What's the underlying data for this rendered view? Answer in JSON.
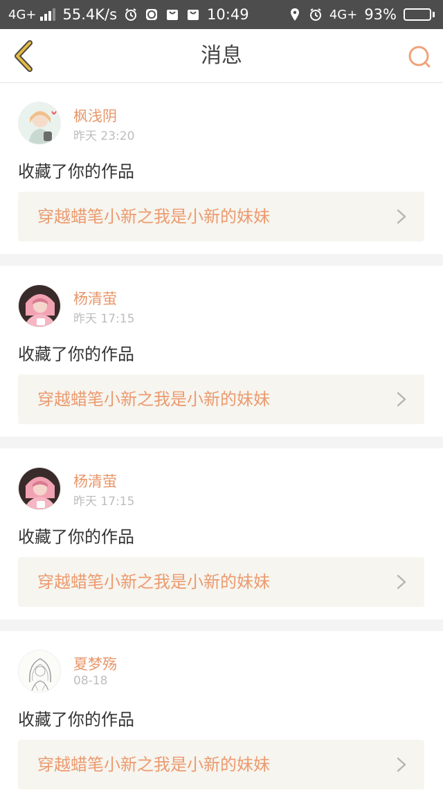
{
  "status_bar": {
    "network_left": "4G+",
    "speed": "55.4K/s",
    "time": "10:49",
    "network_right": "4G+",
    "battery_percent": "93%",
    "battery_level": 0.93,
    "icons_left": [
      "signal-icon",
      "alarm-icon",
      "app-icon",
      "bag-icon",
      "bag-icon"
    ],
    "icons_right": [
      "location-icon",
      "alarm-icon"
    ]
  },
  "nav": {
    "title": "消息",
    "back_icon": "chevron-left-icon",
    "search_icon": "search-icon",
    "accent": "#e0a93a",
    "search_color": "#f0a27a"
  },
  "colors": {
    "username": "#e79668",
    "work_title": "#ec9a6f",
    "work_bg": "#f6f5ef"
  },
  "messages": [
    {
      "username": "枫浅阴",
      "time": "昨天 23:20",
      "action": "收藏了你的作品",
      "work_title": "穿越蜡笔小新之我是小新的妹妹",
      "avatar": "anime-girl-avatar-light"
    },
    {
      "username": "杨清萤",
      "time": "昨天 17:15",
      "action": "收藏了你的作品",
      "work_title": "穿越蜡笔小新之我是小新的妹妹",
      "avatar": "photo-girl-avatar-pink"
    },
    {
      "username": "杨清萤",
      "time": "昨天 17:15",
      "action": "收藏了你的作品",
      "work_title": "穿越蜡笔小新之我是小新的妹妹",
      "avatar": "photo-girl-avatar-pink"
    },
    {
      "username": "夏梦殇",
      "time": "08-18",
      "action": "收藏了你的作品",
      "work_title": "穿越蜡笔小新之我是小新的妹妹",
      "avatar": "sketch-girl-avatar"
    }
  ]
}
